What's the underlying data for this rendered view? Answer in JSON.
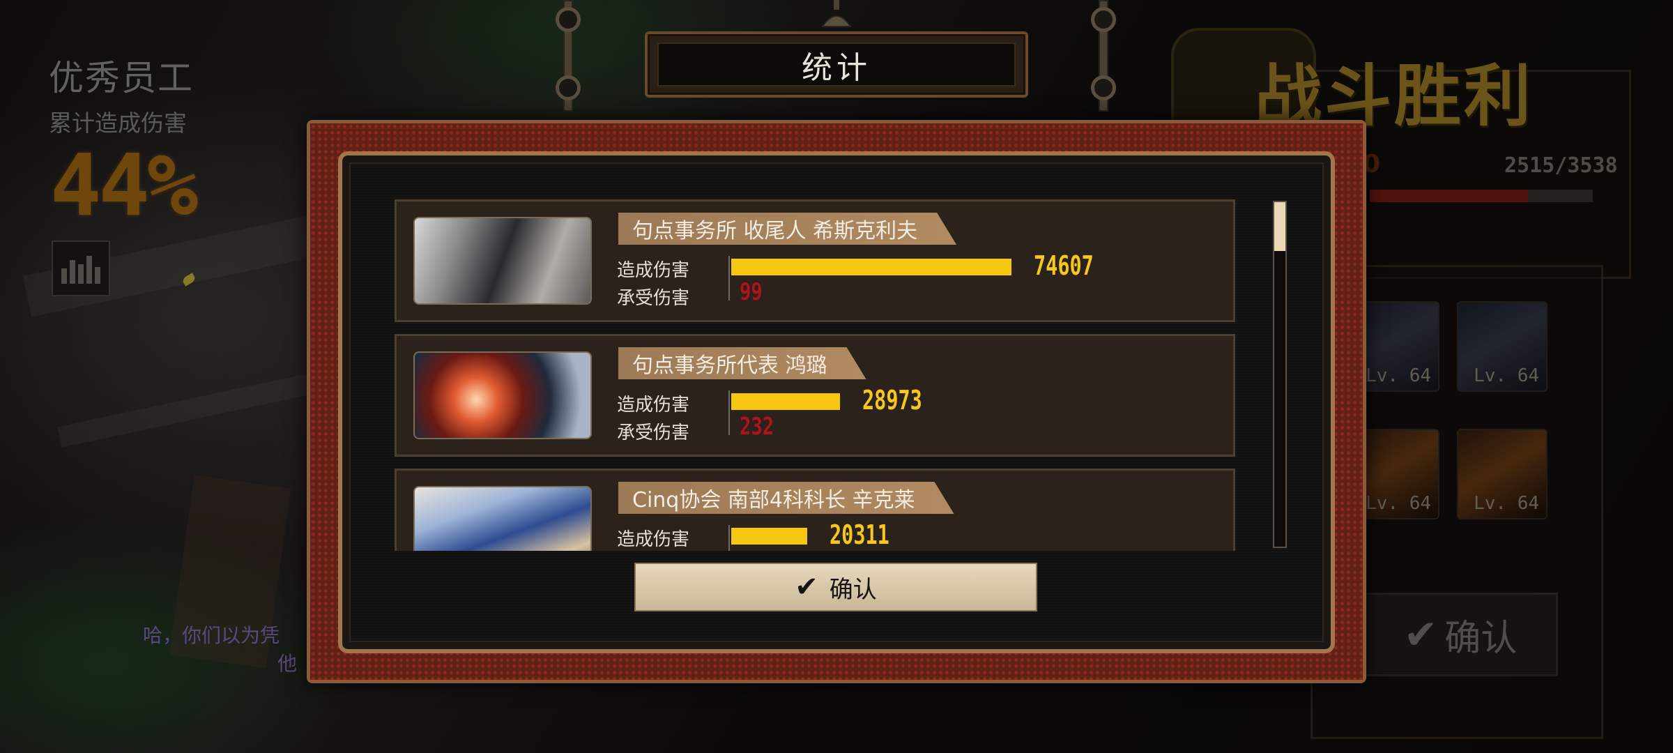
{
  "background": {
    "mvp": {
      "title": "优秀员工",
      "subtitle": "累计造成伤害",
      "percent": "44%"
    },
    "quote": {
      "line1": "哈，你们以为凭",
      "line2": "他"
    },
    "victory_title": "战斗胜利",
    "exp": {
      "partial": "0",
      "text": "2515/3538",
      "value": 2515,
      "max": 3538
    },
    "units": [
      {
        "level": "Lv. 64"
      },
      {
        "level": "Lv. 64"
      },
      {
        "level": "Lv. 64"
      },
      {
        "level": "Lv. 64"
      }
    ],
    "confirm_label": "确认"
  },
  "modal": {
    "title": "统计",
    "damage_label": "造成伤害",
    "taken_label": "承受伤害",
    "max_damage": 74607,
    "rows": [
      {
        "name": "句点事务所 收尾人 希斯克利夫",
        "damage": 74607,
        "damage_text": "74607",
        "taken": 99,
        "taken_text": "99"
      },
      {
        "name": "句点事务所代表 鸿璐",
        "damage": 28973,
        "damage_text": "28973",
        "taken": 232,
        "taken_text": "232"
      },
      {
        "name": "Cinq协会 南部4科科长 辛克莱",
        "damage": 20311,
        "damage_text": "20311"
      }
    ],
    "scroll_position": 0.0,
    "confirm_label": "确认"
  },
  "colors": {
    "damage_bar": "#f5c612",
    "damage_text": "#f7c81c",
    "taken_text": "#b0121a",
    "modal_frame": "#a0764a",
    "victory": "#b8912e"
  },
  "icons": [
    "stats-chart-icon",
    "check-icon"
  ]
}
